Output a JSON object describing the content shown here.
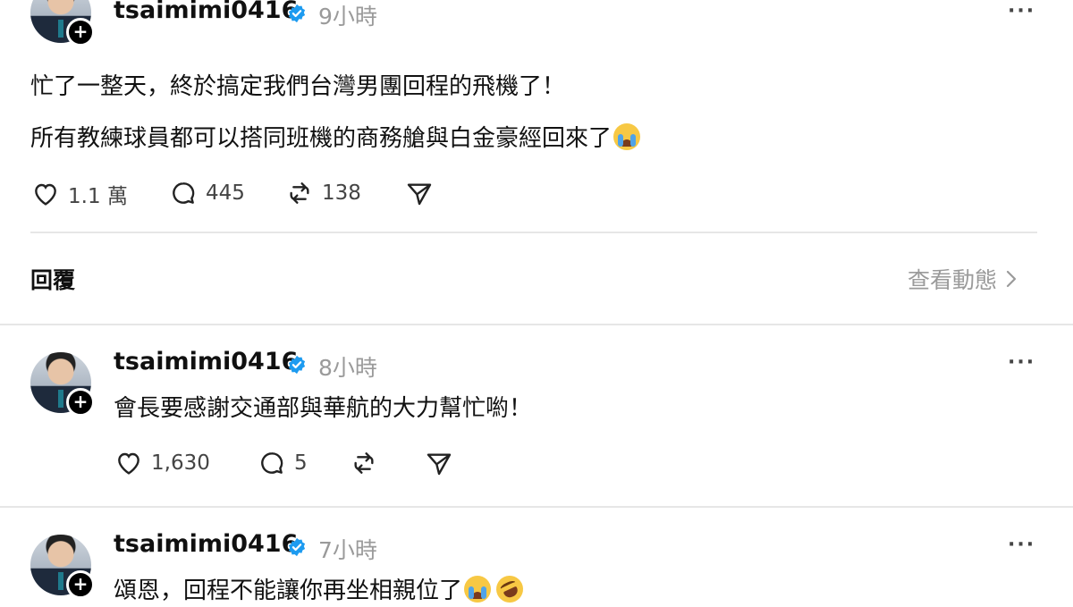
{
  "main_post": {
    "username": "tsaimimi0416",
    "time": "9小時",
    "more": "···",
    "line1": "忙了一整天，終於搞定我們台灣男團回程的飛機了！",
    "line2": "所有教練球員都可以搭同班機的商務艙與白金豪經回來了",
    "line2_emoji": "loudly-crying-face",
    "likes": "1.1 萬",
    "comments": "445",
    "reposts": "138"
  },
  "replies_header": {
    "label": "回覆",
    "activity_link": "查看動態",
    "activity_icon": "chevron-right-icon"
  },
  "replies": [
    {
      "username": "tsaimimi0416",
      "time": "8小時",
      "more": "···",
      "text": "會長要感謝交通部與華航的大力幫忙喲！",
      "likes": "1,630",
      "comments": "5"
    },
    {
      "username": "tsaimimi0416",
      "time": "7小時",
      "more": "···",
      "text": "頌恩，回程不能讓你再坐相親位了",
      "emojis": [
        "loudly-crying-face",
        "rolling-on-the-floor-laughing-face"
      ]
    }
  ],
  "colors": {
    "verified": "#1d9bf0",
    "text": "#101010",
    "muted": "#9a9a9a",
    "divider": "#e6e6e6"
  }
}
